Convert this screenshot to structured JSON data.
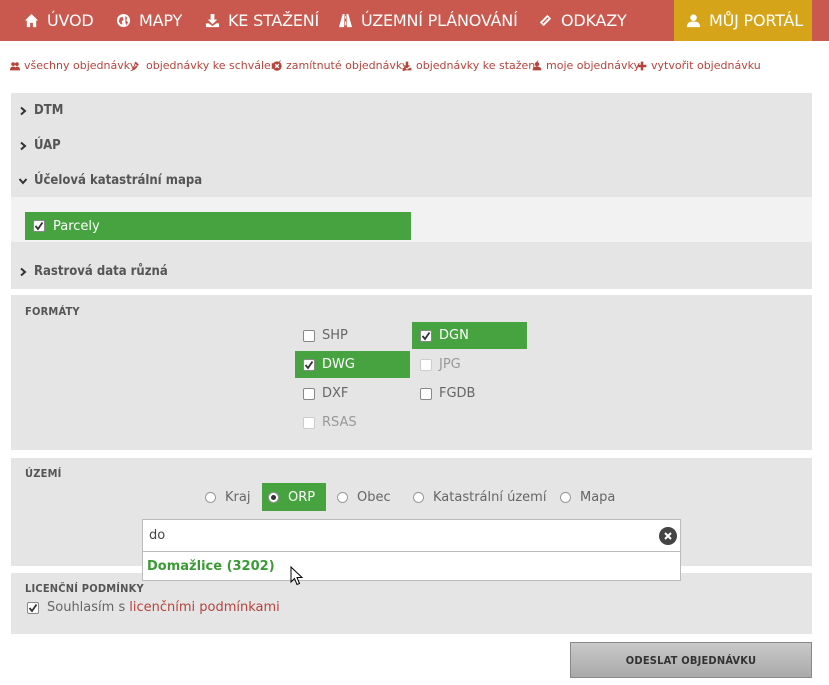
{
  "nav": {
    "items": [
      {
        "label": "ÚVOD",
        "icon": "home-icon"
      },
      {
        "label": "MAPY",
        "icon": "globe-icon"
      },
      {
        "label": "KE STAŽENÍ",
        "icon": "download-icon"
      },
      {
        "label": "ÚZEMNÍ PLÁNOVÁNÍ",
        "icon": "road-icon"
      },
      {
        "label": "ODKAZY",
        "icon": "link-icon"
      }
    ],
    "portal": {
      "label": "MŮJ PORTÁL",
      "icon": "user-icon"
    }
  },
  "sublinks": [
    {
      "label": "všechny objednávky",
      "icon": "users-icon"
    },
    {
      "label": "objednávky ke schválení",
      "icon": "gavel-icon"
    },
    {
      "label": "zamítnuté objednávky",
      "icon": "x-circle-icon"
    },
    {
      "label": "objednávky ke stažení",
      "icon": "download-icon"
    },
    {
      "label": "moje objednávky",
      "icon": "user-icon"
    },
    {
      "label": "vytvořit objednávku",
      "icon": "plus-icon"
    }
  ],
  "categories": {
    "dtm": "DTM",
    "uap": "ÚAP",
    "ucelova": "Účelová katastrální mapa",
    "rastrova": "Rastrová data různá",
    "parcely": "Parcely"
  },
  "formaty": {
    "title": "FORMÁTY",
    "items": [
      {
        "label": "SHP",
        "checked": false,
        "enabled": true
      },
      {
        "label": "DGN",
        "checked": true,
        "enabled": true
      },
      {
        "label": "DWG",
        "checked": true,
        "enabled": true
      },
      {
        "label": "JPG",
        "checked": false,
        "enabled": false
      },
      {
        "label": "DXF",
        "checked": false,
        "enabled": true
      },
      {
        "label": "FGDB",
        "checked": false,
        "enabled": true
      },
      {
        "label": "RSAS",
        "checked": false,
        "enabled": false
      }
    ]
  },
  "uzemi": {
    "title": "ÚZEMÍ",
    "options": [
      "Kraj",
      "ORP",
      "Obec",
      "Katastrální území",
      "Mapa"
    ],
    "selected": "ORP",
    "search_value": "do",
    "suggestion": "Domažlice (3202)"
  },
  "licence": {
    "title": "LICENČNÍ PODMÍNKY",
    "text": "Souhlasím s",
    "link": "licenčními podmínkami",
    "checked": true
  },
  "submit_label": "ODESLAT OBJEDNÁVKU",
  "colors": {
    "nav_bg": "#c9594f",
    "portal_bg": "#d5a418",
    "selected_green": "#46a340",
    "link_red": "#b6443c"
  }
}
